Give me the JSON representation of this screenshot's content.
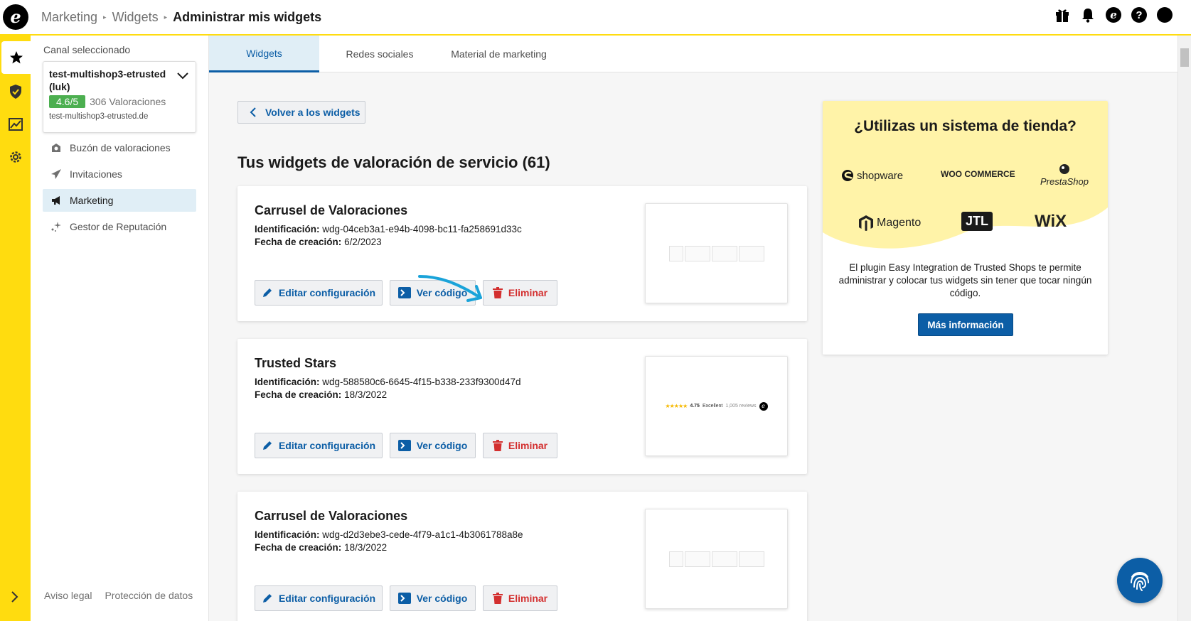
{
  "breadcrumb": {
    "items": [
      "Marketing",
      "Widgets"
    ],
    "current": "Administrar mis widgets"
  },
  "top_icons": [
    "gift-icon",
    "bell-icon",
    "trusted-shops-icon",
    "help-icon",
    "user-icon"
  ],
  "sidebar": {
    "channel_label": "Canal seleccionado",
    "channel_name": "test-multishop3-etrusted (luk)",
    "rating": "4.6/5",
    "reviews_count": "306 Valoraciones",
    "channel_url": "test-multishop3-etrusted.de",
    "nav": [
      {
        "label": "Buzón de valoraciones",
        "icon": "inbox-icon"
      },
      {
        "label": "Invitaciones",
        "icon": "paper-plane-icon"
      },
      {
        "label": "Marketing",
        "icon": "megaphone-icon",
        "active": true
      },
      {
        "label": "Gestor de Reputación",
        "icon": "sparkle-icon"
      }
    ],
    "footer": {
      "legal": "Aviso legal",
      "privacy": "Protección de datos"
    }
  },
  "tabs": [
    {
      "label": "Widgets",
      "active": true
    },
    {
      "label": "Redes sociales"
    },
    {
      "label": "Material de marketing"
    }
  ],
  "back_button": "Volver a los widgets",
  "section_title": "Tus widgets de valoración de servicio (61)",
  "labels": {
    "id": "Identificación:",
    "date": "Fecha de creación:",
    "edit": "Editar configuración",
    "code": "Ver código",
    "delete": "Eliminar"
  },
  "widgets": [
    {
      "title": "Carrusel de Valoraciones",
      "id": "wdg-04ceb3a1-e94b-4098-bc11-fa258691d33c",
      "date": "6/2/2023",
      "preview": "carousel"
    },
    {
      "title": "Trusted Stars",
      "id": "wdg-588580c6-6645-4f15-b338-233f9300d47d",
      "date": "18/3/2022",
      "preview": "stars"
    },
    {
      "title": "Carrusel de Valoraciones",
      "id": "wdg-d2d3ebe3-cede-4f79-a1c1-4b3061788a8e",
      "date": "18/3/2022",
      "preview": "carousel"
    }
  ],
  "stars_preview": {
    "stars": "★★★★★",
    "score": "4.75",
    "label": "Excellent",
    "reviews": "1,005 reviews"
  },
  "promo": {
    "title": "¿Utilizas un sistema de tienda?",
    "logos": [
      "shopware",
      "WOO COMMERCE",
      "PrestaShop",
      "Magento",
      "JTL",
      "WiX"
    ],
    "text": "El plugin Easy Integration de Trusted Shops te permite administrar y colocar tus widgets sin tener que tocar ningún código.",
    "button": "Más información"
  },
  "colors": {
    "accent": "#ffdc0f",
    "primary": "#0c5ea6",
    "danger": "#d32f2f",
    "rating_green": "#4caf50"
  }
}
